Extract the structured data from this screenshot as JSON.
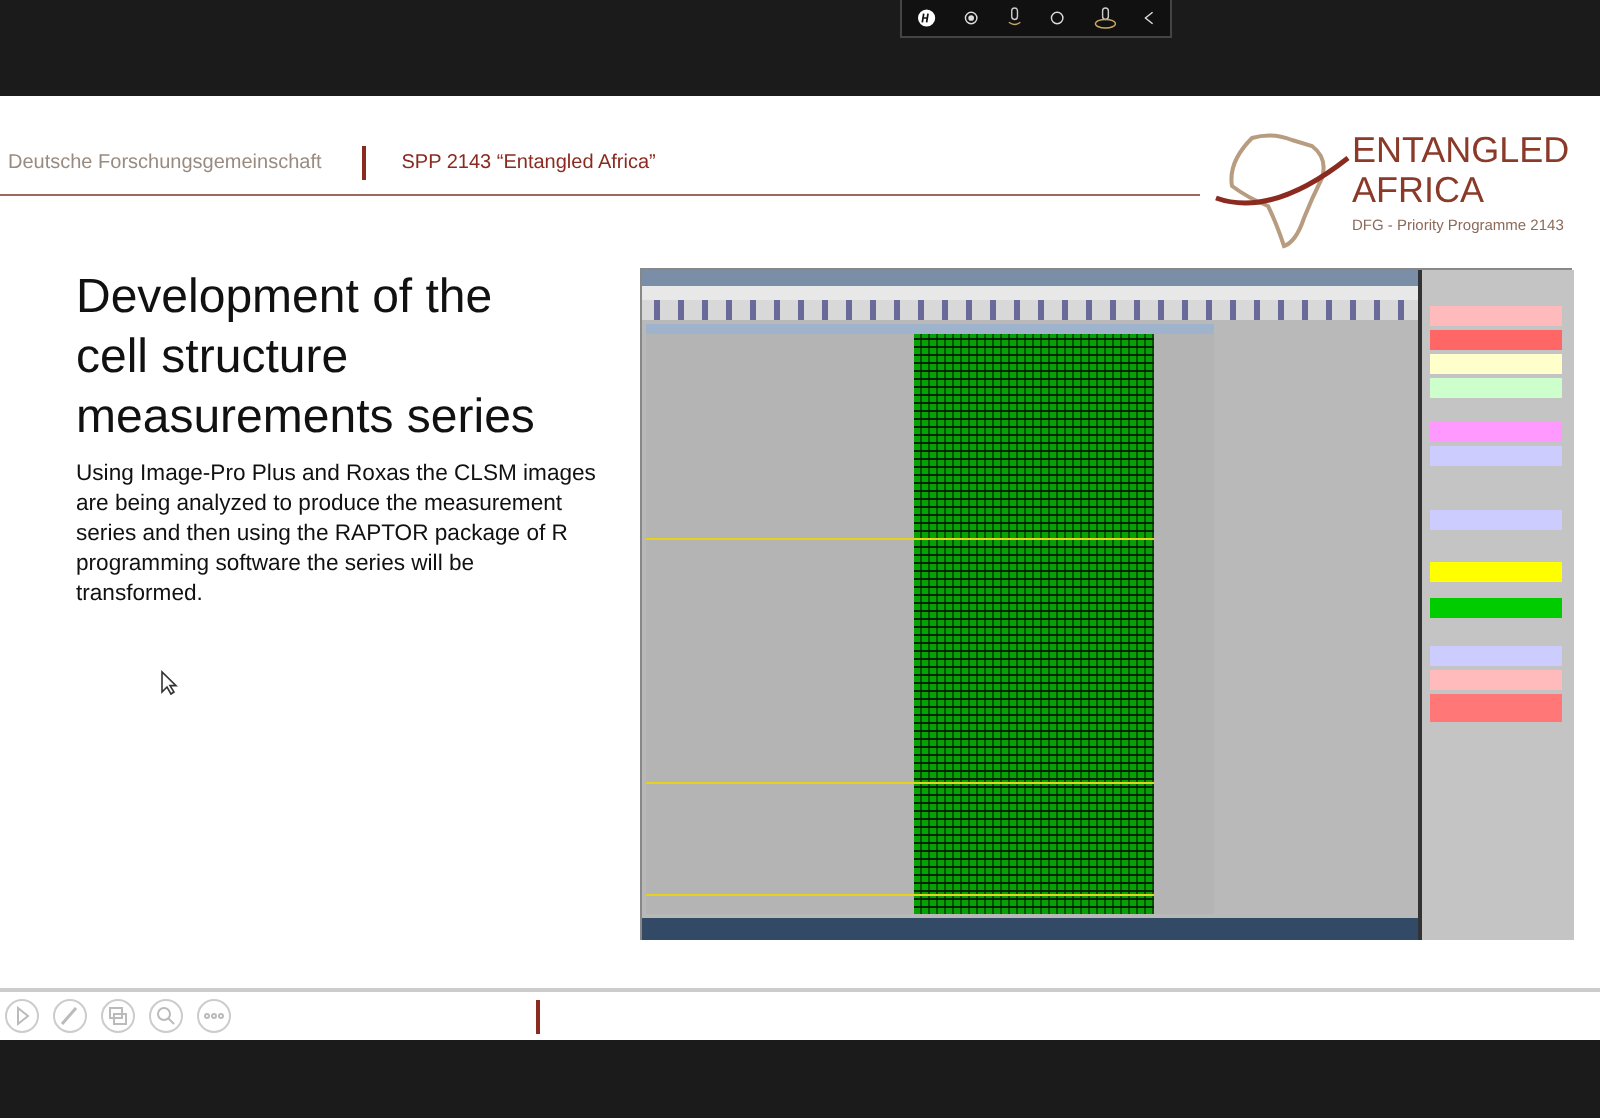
{
  "header": {
    "organization": "Deutsche Forschungsgemeinschaft",
    "program": "SPP 2143 “Entangled Africa”"
  },
  "logo": {
    "line_1": "ENTANGLED",
    "line_2": "AFRICA",
    "tagline": "DFG - Priority Programme 2143"
  },
  "slide": {
    "title": "Development of the cell structure measurements series",
    "body": "Using Image-Pro Plus and Roxas the CLSM images are being analyzed to produce the measurement series and then using the RAPTOR package of R programming software the series will be transformed."
  }
}
